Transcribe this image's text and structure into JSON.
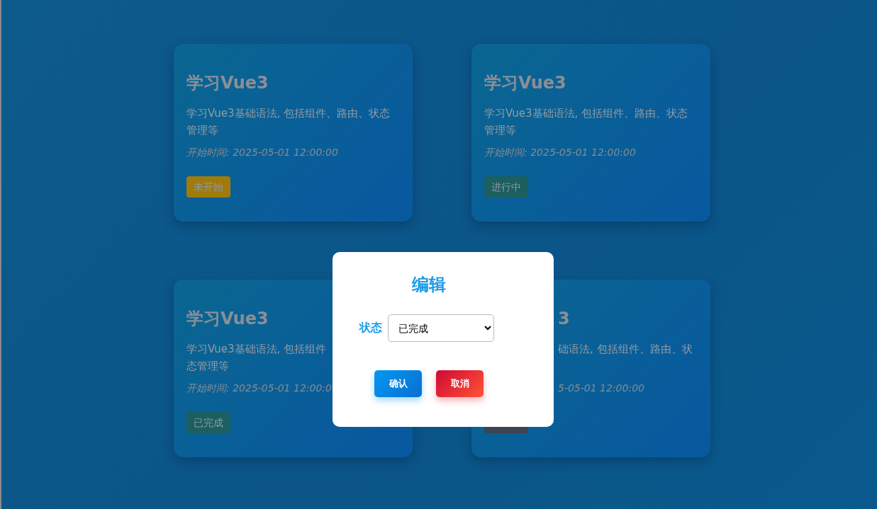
{
  "cards": [
    {
      "kind": "open",
      "title": "学习Vue3",
      "description": "学习Vue3基础语法, 包括组件、路由、状态管理等",
      "start_time": "开始时间: 2025-05-01 12:00:00",
      "status": {
        "label": "未开始",
        "color": "#a07b0c"
      }
    },
    {
      "kind": "open",
      "title": "学习Vue3",
      "description": "学习Vue3基础语法, 包括组件、路由、状态管理等",
      "start_time": "开始时间: 2025-05-01 12:00:00",
      "status": {
        "label": "进行中",
        "color": "#1b5f5f"
      }
    },
    {
      "kind": "open",
      "title": "学习Vue3",
      "description_lines": [
        "学习Vue3基础语法, 包括组件",
        "态管理等"
      ],
      "start_time": "开始时间: 2025-05-01 12:00:0",
      "status": {
        "label": "已完成",
        "color": "#1b5f5f"
      }
    },
    {
      "kind": "cut-left",
      "title": "3",
      "description_lines": [
        "础语法, 包括组件、路由、状"
      ],
      "start_time": "5-05-01 12:00:00",
      "status": {
        "color": "#3d4650"
      }
    }
  ],
  "dialog": {
    "title": "编辑",
    "field": {
      "label": "状态",
      "value": "已完成"
    },
    "buttons": [
      {
        "label": "确认",
        "kind": "confirm"
      },
      {
        "label": "取消",
        "kind": "cancel"
      }
    ]
  }
}
